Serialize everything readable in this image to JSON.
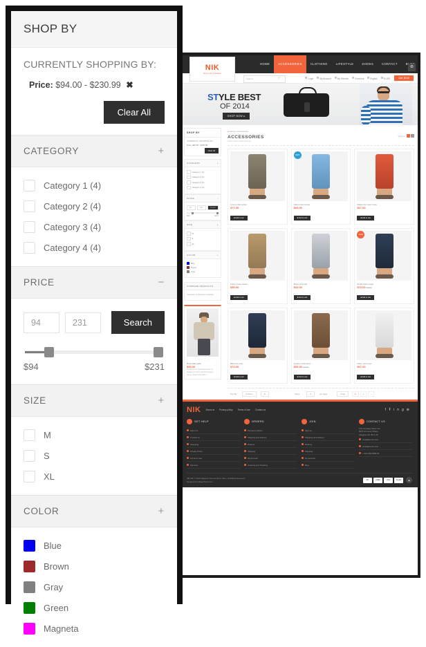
{
  "panel": {
    "title": "SHOP BY",
    "currently_shopping": {
      "heading": "CURRENTLY SHOPPING BY:",
      "label": "Price:",
      "value": "$94.00 - $230.99",
      "remove_icon": "✖",
      "clear_all": "Clear All"
    },
    "sections": {
      "category": {
        "title": "CATEGORY",
        "sign": "+",
        "items": [
          {
            "label": "Category 1 (4)"
          },
          {
            "label": "Category 2 (4)"
          },
          {
            "label": "Category 3 (4)"
          },
          {
            "label": "Category 4 (4)"
          }
        ]
      },
      "price": {
        "title": "PRICE",
        "sign": "−",
        "min_value": "94",
        "max_value": "231",
        "search_label": "Search",
        "min_display": "$94",
        "max_display": "$231"
      },
      "size": {
        "title": "SIZE",
        "sign": "+",
        "items": [
          {
            "label": "M"
          },
          {
            "label": "S"
          },
          {
            "label": "XL"
          }
        ]
      },
      "color": {
        "title": "COLOR",
        "sign": "+",
        "items": [
          {
            "label": "Blue",
            "hex": "#0000ee"
          },
          {
            "label": "Brown",
            "hex": "#9e2b2b"
          },
          {
            "label": "Gray",
            "hex": "#808080"
          },
          {
            "label": "Green",
            "hex": "#008000"
          },
          {
            "label": "Magneta",
            "hex": "#ff00ff"
          }
        ]
      }
    }
  },
  "site": {
    "logo": {
      "name": "NIK",
      "tagline": "shop men's fashion"
    },
    "menu": [
      {
        "label": "HOME",
        "active": false
      },
      {
        "label": "ACCESSORIES",
        "active": true
      },
      {
        "label": "CLOTHING",
        "active": false
      },
      {
        "label": "LIFESTYLE",
        "active": false
      },
      {
        "label": "SHOES",
        "active": false
      },
      {
        "label": "CONTACT",
        "active": false
      },
      {
        "label": "BLOG",
        "active": false
      }
    ],
    "search_placeholder": "Search...",
    "utility": [
      {
        "label": "Login"
      },
      {
        "label": "My Account"
      },
      {
        "label": "My Wishlist"
      },
      {
        "label": "Checkout"
      },
      {
        "label": "English"
      },
      {
        "label": "$ USD"
      }
    ],
    "cart_label": "Cart: $0.00",
    "banner": {
      "line1_a": "ST",
      "line1_b": "YLE BEST",
      "line2": "OF 2014",
      "button": "SHOP NOW ▸"
    },
    "breadcrumb": {
      "home": "Home",
      "sep": "»",
      "current": "Accessories"
    },
    "category": {
      "title": "ACCESSORIES",
      "subtitle": "Lorem ipsum dolor sit amet",
      "view_as": "View as:"
    },
    "sidebar": {
      "title": "SHOP BY",
      "currently_heading": "CURRENTLY SHOPPING BY:",
      "currently_value": "Price:  $94.00 - $230.99",
      "clear_all": "Clear All",
      "category_title": "CATEGORY",
      "categories": [
        "Category 1 (4)",
        "Category 2 (4)",
        "Category 3 (4)",
        "Category 4 (4)"
      ],
      "price_title": "PRICE",
      "price_min": "94",
      "price_max": "231",
      "price_search": "Search",
      "price_min_display": "$94",
      "price_max_display": "$231",
      "size_title": "SIZE",
      "sizes": [
        "M",
        "S",
        "XL"
      ],
      "color_title": "COLOR",
      "colors": [
        {
          "label": "Blue",
          "hex": "#0000ee"
        },
        {
          "label": "Brown",
          "hex": "#9e2b2b"
        },
        {
          "label": "Gray",
          "hex": "#808080"
        }
      ],
      "compare_title": "COMPARE PRODUCTS",
      "compare_empty": "You have no items to compare.",
      "featured": {
        "name": "Rose daku pase",
        "price": "$95.00",
        "desc": "Vestibulum et scelerisque ante, eu sodales mi. Nunc tincidunt tempus varius. Integer ante dolor. ..."
      }
    },
    "products": [
      {
        "name": "Loren miten polas",
        "price": "$77.00",
        "old_price": "",
        "badge": "",
        "cart": "Add to cart"
      },
      {
        "name": "Ukan mazi rentas",
        "price": "$65.00",
        "old_price": "",
        "badge": "NEW",
        "cart": "Add to cart"
      },
      {
        "name": "Molas tren open zase",
        "price": "$67.00",
        "old_price": "",
        "badge": "",
        "cart": "Add to cart"
      },
      {
        "name": "Futen moten katen",
        "price": "$56.00",
        "old_price": "",
        "badge": "",
        "cart": "Add to cart"
      },
      {
        "name": "Mase pola taki",
        "price": "$32.00",
        "old_price": "",
        "badge": "",
        "cart": "Add to cart"
      },
      {
        "name": "Simas kiten rugas",
        "price": "$70.00",
        "old_price": "$78.00",
        "badge": "SALE",
        "cart": "Add to cart"
      },
      {
        "name": "Bika lore pisa",
        "price": "$74.00",
        "old_price": "",
        "badge": "",
        "cart": "Add to cart"
      },
      {
        "name": "Quase muza sima",
        "price": "$60.00",
        "old_price": "$68.00",
        "badge": "",
        "cart": "Add to cart"
      },
      {
        "name": "Nase vace rupo",
        "price": "$67.00",
        "old_price": "",
        "badge": "",
        "cart": "Add to cart"
      }
    ],
    "toolbar": {
      "sort_label": "Sort By:",
      "sort_value": "Position",
      "show_label": "Show",
      "show_value": "9",
      "per_page": "per page",
      "page_label": "Page",
      "pages": [
        "1",
        "2",
        "›"
      ]
    },
    "footer": {
      "links": [
        "About us",
        "Privacy policy",
        "Terms of use",
        "Contact us"
      ],
      "social": [
        "f",
        "Ŧ",
        "in",
        "g",
        "⊕"
      ],
      "columns": [
        {
          "title": "GET HELP",
          "items": [
            "About us",
            "Contact us",
            "Shopping",
            "Privacy Policy",
            "Terms of Use",
            "Services"
          ]
        },
        {
          "title": "ORDERS",
          "items": [
            "Payment options",
            "Shipping and delivery",
            "Returns",
            "Shipping",
            "My Account",
            "Ordering and Tracking"
          ]
        },
        {
          "title": "JOIN",
          "items": [
            "Sign up",
            "Shipping and delivery",
            "Returns",
            "Shipping",
            "My Account",
            "Blog"
          ]
        }
      ],
      "contact": {
        "title": "CONTACT US",
        "address": "The Company Name Inc.\n9675 St Vincent Place,\nGlasgow, DC 45 Fr 45.",
        "email1": "email@smdn.com",
        "email2": "email@smdn.com",
        "phone": "+ 001 666 8989 55"
      },
      "copyright": "SM NIK © 2014 Magento Themes Demo Store. All Rights Reserved.",
      "designed": "Designed by MagenTech.Com",
      "payments": [
        "MC",
        "AMEX",
        "VISA",
        "PayPal"
      ],
      "back_to_top": "▲"
    }
  }
}
